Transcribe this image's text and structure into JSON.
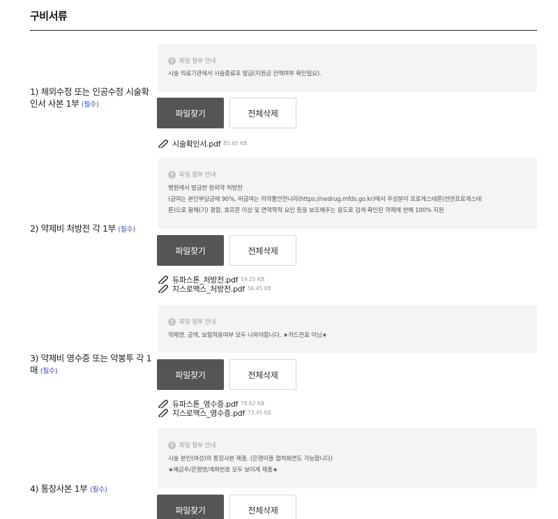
{
  "section_title": "구비서류",
  "notice_title": "파일 첨부 안내",
  "required_label": "(필수)",
  "buttons": {
    "find": "파일찾기",
    "delete_all": "전체삭제"
  },
  "rows": [
    {
      "label": "1) 체외수정 또는 인공수정 시술확인서 사본 1부",
      "notice_lines": [
        "시술 의료기관에서 시술종료후 발급(지원금 잔액여부 확인필요)."
      ],
      "files": [
        {
          "name": "시술확인서.pdf",
          "size": "85.65 KB"
        }
      ]
    },
    {
      "label": "2) 약제비 처방전 각 1부",
      "notice_lines": [
        "병원에서 발급한 원외약 처방전",
        "(급여는 본인부담금에 90%, 비급여는 의약품안전나라(https://nedrug.mfds.go.kr)에서 주성분이 프로게스테론(천연프로게스테",
        "론)으로 황체(기) 결함, 호르몬 이상 및 면역학적 요인 등을 보조해주는 용도로 검색·확인된 약제에 한해 100% 지원"
      ],
      "files": [
        {
          "name": "듀파스톤_처방전.pdf",
          "size": "59.25 KB"
        },
        {
          "name": "지스로맥스_처방전.pdf",
          "size": "56.45 KB"
        }
      ]
    },
    {
      "label": "3) 약제비 영수증 또는 약봉투 각 1매",
      "notice_lines": [
        "약제명, 금액, 보험적용여부 모두 나와야합니다. ★카드전표 아님★"
      ],
      "files": [
        {
          "name": "듀파스톤_영수증.pdf",
          "size": "78.62 KB"
        },
        {
          "name": "지스로맥스_영수증.pdf",
          "size": "73.45 KB"
        }
      ]
    },
    {
      "label": "4) 통장사본 1부",
      "notice_lines": [
        "시술 본인(여성)의 통장사본 제출. (은행어플 캡쳐화면도 가능합니다)",
        "★예금주/은행명/계좌번호 모두 보이게 제출★"
      ],
      "files": []
    }
  ]
}
